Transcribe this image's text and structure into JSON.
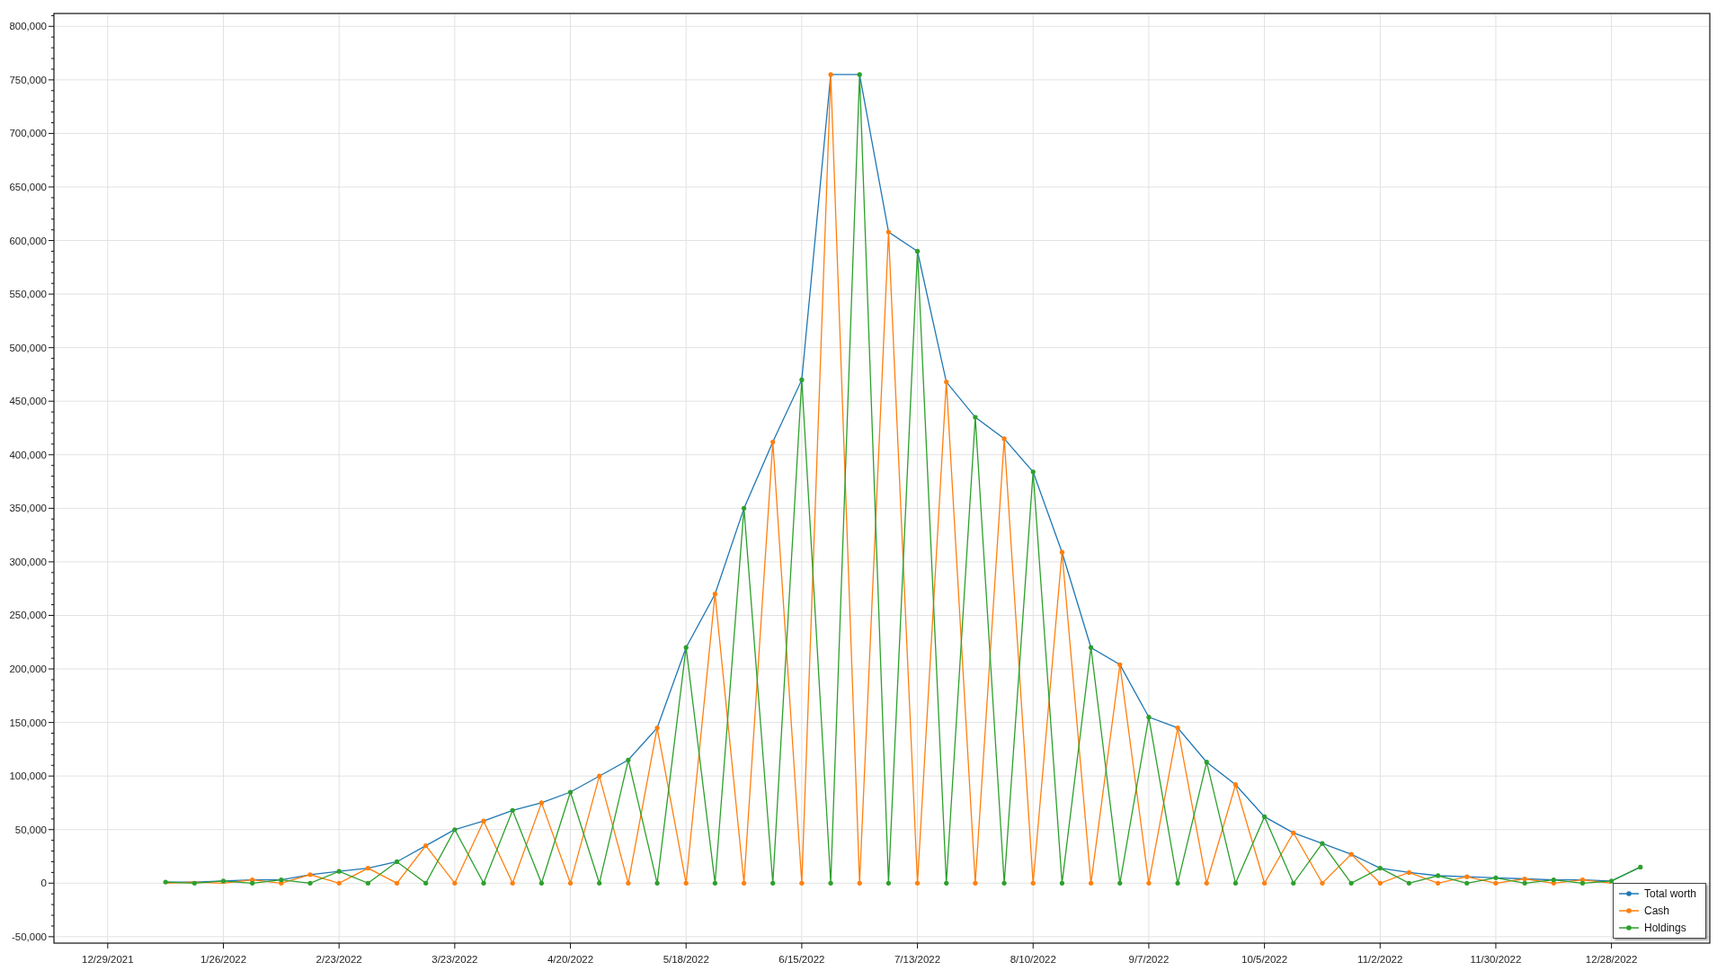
{
  "chart": {
    "chart_data": {
      "type": "line",
      "categories": [
        "12/29/2021",
        null,
        null,
        null,
        "1/26/2022",
        null,
        null,
        null,
        "2/23/2022",
        null,
        null,
        null,
        "3/23/2022",
        null,
        null,
        null,
        "4/20/2022",
        null,
        null,
        null,
        "5/18/2022",
        null,
        null,
        null,
        "6/15/2022",
        null,
        null,
        null,
        "7/13/2022",
        null,
        null,
        null,
        "8/10/2022",
        null,
        null,
        null,
        "9/7/2022",
        null,
        null,
        null,
        "10/5/2022",
        null,
        null,
        null,
        "11/2/2022",
        null,
        null,
        null,
        "11/30/2022",
        null,
        null,
        null,
        "12/28/2022",
        null
      ],
      "series": [
        {
          "name": "Total worth",
          "color": "#1f77b4",
          "values": [
            null,
            null,
            1000,
            1000,
            2000,
            3000,
            3000,
            8000,
            11000,
            14000,
            20000,
            35000,
            50000,
            58000,
            68000,
            75000,
            85000,
            100000,
            115000,
            145000,
            220000,
            270000,
            350000,
            412000,
            470000,
            755000,
            755000,
            608000,
            590000,
            468000,
            435000,
            415000,
            384000,
            309000,
            220000,
            204000,
            155000,
            145000,
            113000,
            92000,
            62000,
            47000,
            37000,
            27000,
            14000,
            10000,
            7000,
            6000,
            5000,
            4000,
            3000,
            3000,
            2000,
            15000
          ]
        },
        {
          "name": "Cash",
          "color": "#ff7f0e",
          "values": [
            null,
            null,
            0,
            1000,
            0,
            3000,
            0,
            8000,
            0,
            14000,
            0,
            35000,
            0,
            58000,
            0,
            75000,
            0,
            100000,
            0,
            145000,
            0,
            270000,
            0,
            412000,
            0,
            755000,
            0,
            608000,
            0,
            468000,
            0,
            415000,
            0,
            309000,
            0,
            204000,
            0,
            145000,
            0,
            92000,
            0,
            47000,
            0,
            27000,
            0,
            10000,
            0,
            6000,
            0,
            4000,
            0,
            3000,
            0,
            null
          ]
        },
        {
          "name": "Holdings",
          "color": "#2ca02c",
          "values": [
            null,
            null,
            1000,
            0,
            2000,
            0,
            3000,
            0,
            11000,
            0,
            20000,
            0,
            50000,
            0,
            68000,
            0,
            85000,
            0,
            115000,
            0,
            220000,
            0,
            350000,
            0,
            470000,
            0,
            755000,
            0,
            590000,
            0,
            435000,
            0,
            384000,
            0,
            220000,
            0,
            155000,
            0,
            113000,
            0,
            62000,
            0,
            37000,
            0,
            14000,
            0,
            7000,
            0,
            5000,
            0,
            3000,
            0,
            2000,
            15000
          ]
        }
      ],
      "grid": true,
      "ylim": [
        -56000,
        812000
      ],
      "yticks": [
        {
          "value": -50000,
          "label": "-50,000"
        },
        {
          "value": 0,
          "label": "0"
        },
        {
          "value": 50000,
          "label": "50,000"
        },
        {
          "value": 100000,
          "label": "100,000"
        },
        {
          "value": 150000,
          "label": "150,000"
        },
        {
          "value": 200000,
          "label": "200,000"
        },
        {
          "value": 250000,
          "label": "250,000"
        },
        {
          "value": 300000,
          "label": "300,000"
        },
        {
          "value": 350000,
          "label": "350,000"
        },
        {
          "value": 400000,
          "label": "400,000"
        },
        {
          "value": 450000,
          "label": "450,000"
        },
        {
          "value": 500000,
          "label": "500,000"
        },
        {
          "value": 550000,
          "label": "550,000"
        },
        {
          "value": 600000,
          "label": "600,000"
        },
        {
          "value": 650000,
          "label": "650,000"
        },
        {
          "value": 700000,
          "label": "700,000"
        },
        {
          "value": 750000,
          "label": "750,000"
        },
        {
          "value": 800000,
          "label": "800,000"
        }
      ]
    }
  }
}
